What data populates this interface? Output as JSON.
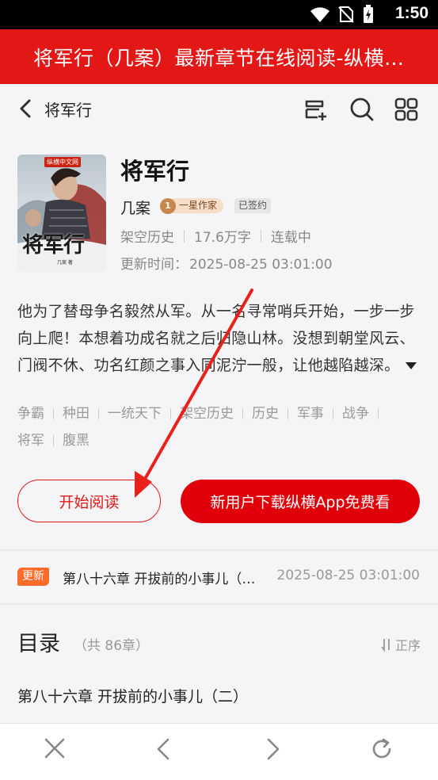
{
  "status_bar": {
    "time": "1:50"
  },
  "browser": {
    "page_title": "将军行（几案）最新章节在线阅读-纵横中文网"
  },
  "nav": {
    "title": "将军行"
  },
  "book": {
    "cover_publisher": "纵横中文网",
    "cover_title": "将军行",
    "cover_author": "几案 著",
    "title": "将军行",
    "author": "几案",
    "level_badge": "一星作家",
    "level_number": "1",
    "signed_badge": "已签约",
    "meta": [
      "架空历史",
      "17.6万字",
      "连载中"
    ],
    "update_label": "更新时间：",
    "update_time": "2025-08-25 03:01:00",
    "intro": "他为了替母争名毅然从军。从一名寻常哨兵开始，一步一步向上爬！本想着功成名就之后归隐山林。没想到朝堂风云、门阀不休、功名红颜之事入同泥泞一般，让他越陷越深。",
    "tags": [
      "争霸",
      "种田",
      "一统天下",
      "架空历史",
      "历史",
      "军事",
      "战争",
      "将军",
      "腹黑"
    ]
  },
  "actions": {
    "read_label": "开始阅读",
    "app_label": "新用户下载纵横App免费看"
  },
  "latest": {
    "badge": "更新",
    "chapter": "第八十六章 开拔前的小事儿（二）",
    "time": "2025-08-25 03:01:00"
  },
  "toc": {
    "title": "目录",
    "count": "（共 86章）",
    "sort_label": "正序",
    "first_item": "第八十六章 开拔前的小事儿（二）"
  },
  "colors": {
    "brand_red": "#e31716",
    "update_orange": "#ff6b2a"
  },
  "icons": [
    "wifi-icon",
    "no-sim-icon",
    "battery-charging-icon",
    "back-chevron-icon",
    "add-to-shelf-icon",
    "search-icon",
    "grid-menu-icon",
    "expand-icon",
    "sort-icon",
    "close-icon",
    "prev-icon",
    "next-icon",
    "refresh-icon"
  ]
}
